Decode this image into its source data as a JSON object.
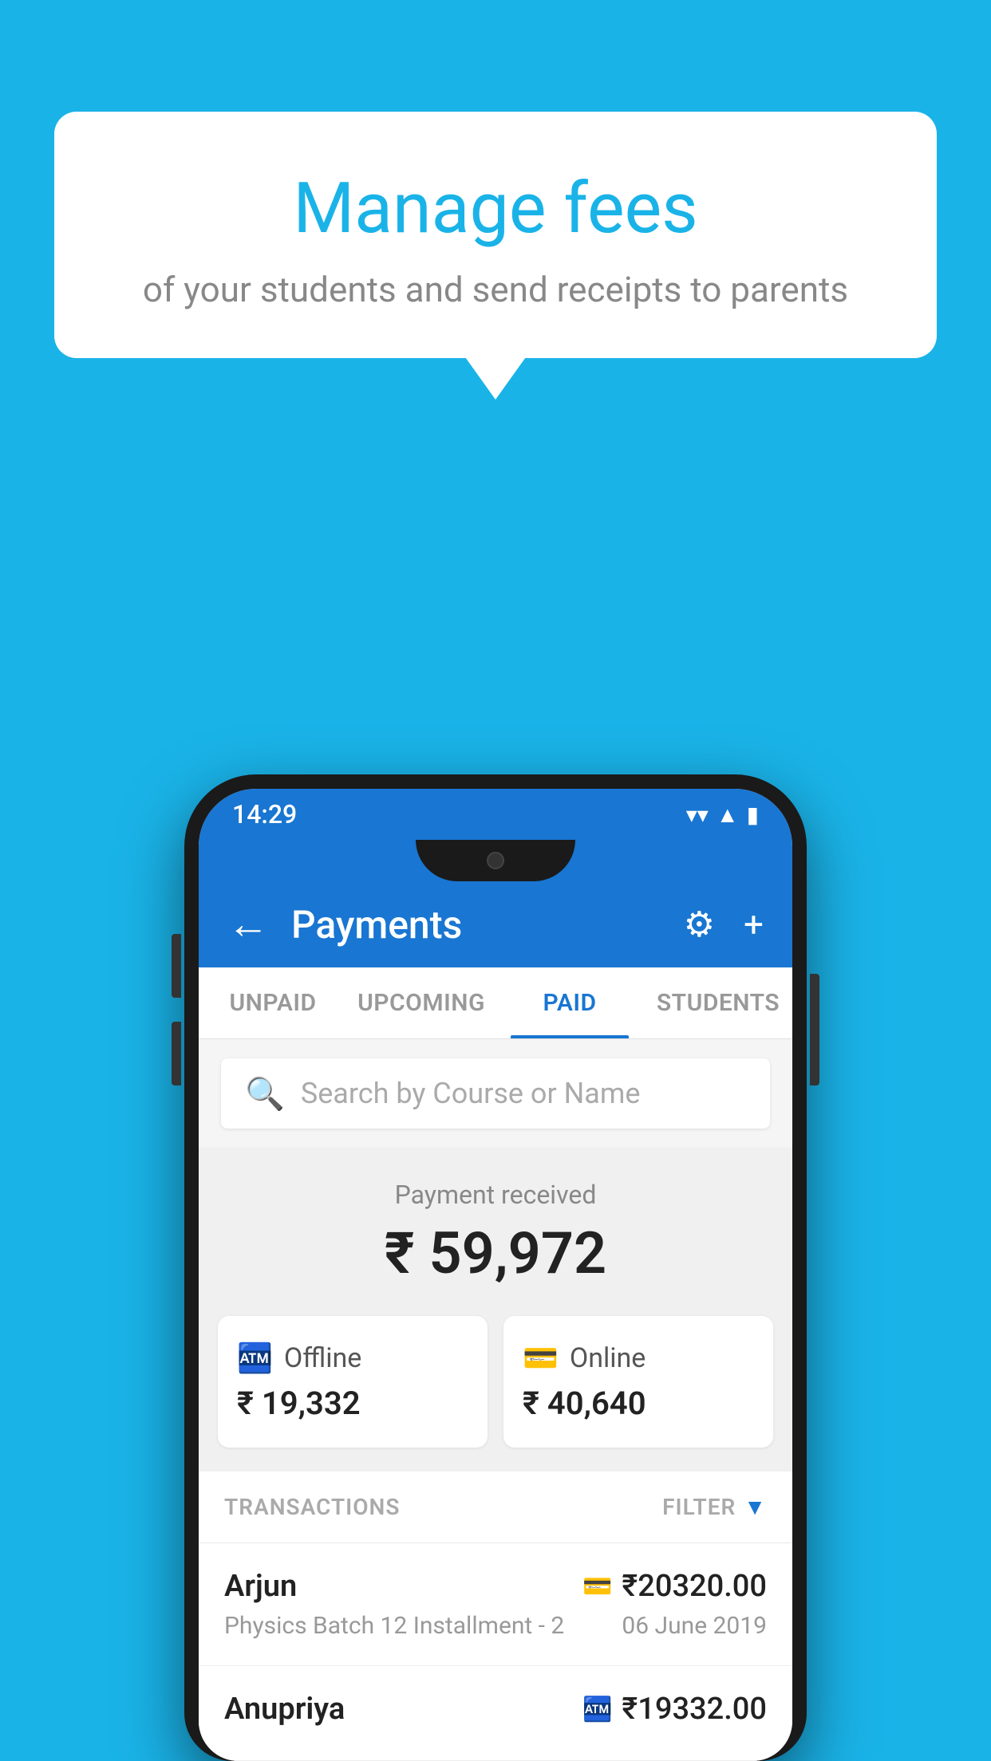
{
  "background_color": "#1ab3e8",
  "bubble": {
    "title": "Manage fees",
    "subtitle": "of your students and send receipts to parents"
  },
  "status_bar": {
    "time": "14:29",
    "wifi": "▼",
    "signal": "▲",
    "battery": "▮"
  },
  "app_bar": {
    "title": "Payments",
    "back_label": "←",
    "gear_label": "⚙",
    "plus_label": "+"
  },
  "tabs": [
    {
      "label": "UNPAID",
      "active": false
    },
    {
      "label": "UPCOMING",
      "active": false
    },
    {
      "label": "PAID",
      "active": true
    },
    {
      "label": "STUDENTS",
      "active": false
    }
  ],
  "search": {
    "placeholder": "Search by Course or Name"
  },
  "payment_summary": {
    "label": "Payment received",
    "amount": "₹ 59,972",
    "offline": {
      "type": "Offline",
      "amount": "₹ 19,332"
    },
    "online": {
      "type": "Online",
      "amount": "₹ 40,640"
    }
  },
  "transactions": {
    "label": "TRANSACTIONS",
    "filter_label": "FILTER",
    "items": [
      {
        "name": "Arjun",
        "amount": "₹20320.00",
        "payment_type": "card",
        "course": "Physics Batch 12 Installment - 2",
        "date": "06 June 2019"
      },
      {
        "name": "Anupriya",
        "amount": "₹19332.00",
        "payment_type": "offline",
        "course": "",
        "date": ""
      }
    ]
  }
}
